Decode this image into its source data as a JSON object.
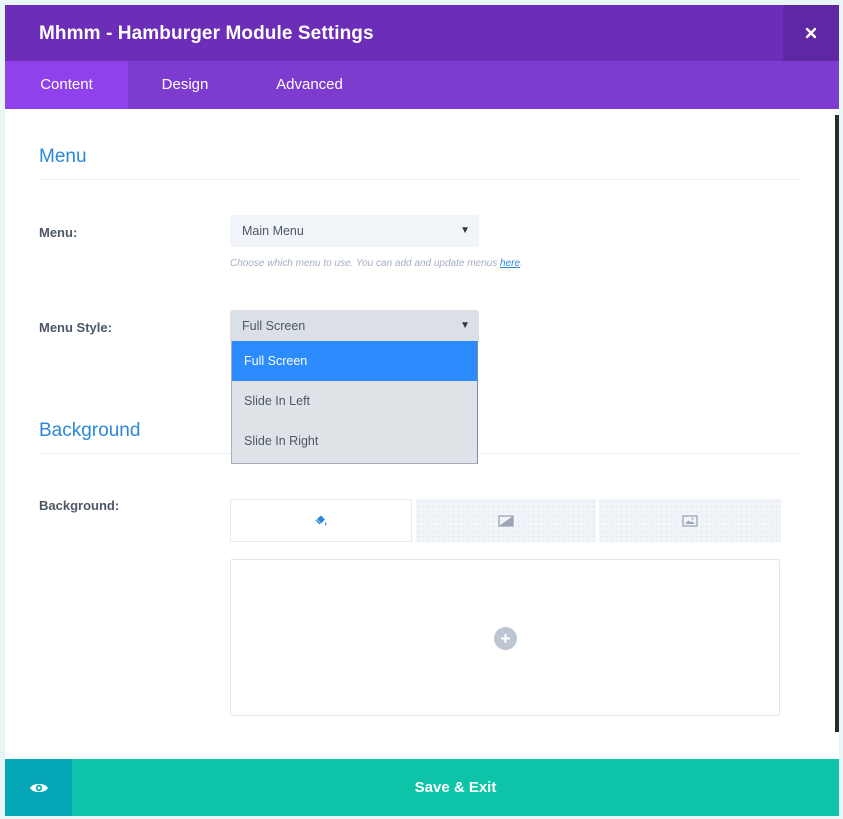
{
  "header": {
    "title": "Mhmm - Hamburger Module Settings",
    "close_icon": "close-icon"
  },
  "tabs": [
    {
      "label": "Content",
      "active": true
    },
    {
      "label": "Design",
      "active": false
    },
    {
      "label": "Advanced",
      "active": false
    }
  ],
  "menu_section": {
    "title": "Menu",
    "menu_label": "Menu:",
    "menu_value": "Main Menu",
    "menu_hint": "Choose which menu to use. You can add and update menus ",
    "menu_hint_link": "here",
    "menu_hint_end": ".",
    "style_label": "Menu Style:",
    "style_value": "Full Screen",
    "style_options": [
      "Full Screen",
      "Slide In Left",
      "Slide In Right"
    ]
  },
  "background_section": {
    "title": "Background",
    "label": "Background:",
    "tabs": [
      "paint-bucket-icon",
      "gradient-icon",
      "image-icon"
    ]
  },
  "footer": {
    "preview_icon": "eye-icon",
    "save_label": "Save & Exit"
  },
  "colors": {
    "header": "#6c2eb9",
    "tabs_bar": "#7e3bd0",
    "active_tab": "#8f42ec",
    "section_title": "#2b87da",
    "selected_option": "#2c8bff",
    "footer": "#0ec4a8",
    "preview_button": "#05a7b7"
  }
}
